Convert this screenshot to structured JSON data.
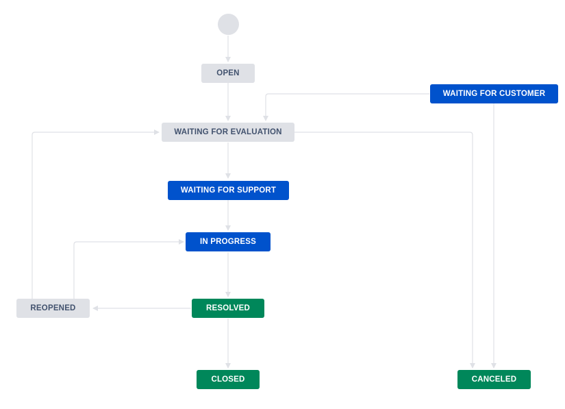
{
  "workflow": {
    "colors": {
      "todo_bg": "#dfe1e6",
      "todo_text": "#42526e",
      "inprogress_bg": "#0052cc",
      "done_bg": "#00875a",
      "edge": "#dfe1e6"
    },
    "statuses": {
      "open": "OPEN",
      "waiting_for_customer": "WAITING FOR CUSTOMER",
      "waiting_for_evaluation": "WAITING FOR EVALUATION",
      "waiting_for_support": "WAITING FOR SUPPORT",
      "in_progress": "IN PROGRESS",
      "reopened": "REOPENED",
      "resolved": "RESOLVED",
      "closed": "CLOSED",
      "canceled": "CANCELED"
    },
    "transitions": [
      {
        "from": "start",
        "to": "open"
      },
      {
        "from": "open",
        "to": "waiting_for_evaluation"
      },
      {
        "from": "waiting_for_customer",
        "to": "waiting_for_evaluation"
      },
      {
        "from": "waiting_for_evaluation",
        "to": "waiting_for_support"
      },
      {
        "from": "waiting_for_evaluation",
        "to": "canceled"
      },
      {
        "from": "waiting_for_customer",
        "to": "canceled"
      },
      {
        "from": "waiting_for_support",
        "to": "in_progress"
      },
      {
        "from": "in_progress",
        "to": "resolved"
      },
      {
        "from": "resolved",
        "to": "reopened"
      },
      {
        "from": "reopened",
        "to": "in_progress"
      },
      {
        "from": "reopened",
        "to": "waiting_for_evaluation"
      },
      {
        "from": "resolved",
        "to": "closed"
      }
    ]
  }
}
